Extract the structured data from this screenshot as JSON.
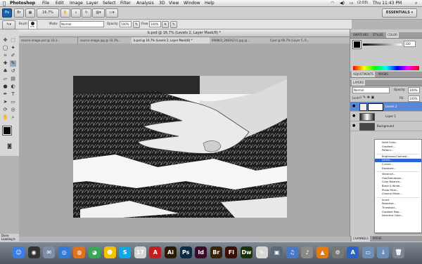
{
  "menubar": {
    "apple_label": "",
    "app_name": "Photoshop",
    "items": [
      "File",
      "Edit",
      "Image",
      "Layer",
      "Select",
      "Filter",
      "Analysis",
      "3D",
      "View",
      "Window",
      "Help"
    ],
    "battery": "(2:03)",
    "clock": "Thu 11:43 PM"
  },
  "appbar": {
    "ps_logo": "Ps",
    "zoom": "16.7%",
    "workspace": "ESSENTIALS ▾"
  },
  "options": {
    "brush_label": "Brush:",
    "brush_size": "175",
    "mode_label": "Mode:",
    "mode_value": "Normal",
    "opacity_label": "Opacity:",
    "opacity_value": "100%",
    "flow_label": "Flow:",
    "flow_value": "100%"
  },
  "document": {
    "title": "b.psd @ 16.7% (Levels 2, Layer Mask/8) *",
    "tabs": [
      "source-image.psd @ 33.3...",
      "source-image.jpg @ 33.3%...",
      "b.psd @ 16.7% (Levels 2, Layer Mask/8) *",
      "898803_26836231.jpg @...",
      "f.psd @ 66.7% (Layer 5, R..."
    ]
  },
  "status": {
    "left_text": "Done",
    "loading_text": "Loading b"
  },
  "panels": {
    "top_tabs": [
      "SWATCHES",
      "STYLES",
      "COLOR"
    ],
    "color_value": "100",
    "adjust_tabs": [
      "ADJUSTMENTS",
      "MASKS"
    ],
    "layers_tab": "LAYERS",
    "blend_mode": "Normal",
    "opacity_label": "Opacity:",
    "opacity_value": "100%",
    "lock_label": "Lock:",
    "fill_label": "Fill:",
    "fill_value": "100%",
    "layers": [
      {
        "name": "Levels 2"
      },
      {
        "name": "Layer 1"
      },
      {
        "name": "Background"
      }
    ],
    "bottom_tabs": [
      "CHANNELS",
      "PATHS"
    ]
  },
  "adjust_menu": [
    {
      "label": "Solid Color..."
    },
    {
      "label": "Gradient..."
    },
    {
      "label": "Pattern..."
    },
    {
      "sep": true
    },
    {
      "label": "Brightness/Contrast..."
    },
    {
      "label": "Levels...",
      "highlight": true
    },
    {
      "label": "Curves..."
    },
    {
      "label": "Exposure..."
    },
    {
      "sep": true
    },
    {
      "label": "Vibrance..."
    },
    {
      "label": "Hue/Saturation..."
    },
    {
      "label": "Color Balance..."
    },
    {
      "label": "Black & White..."
    },
    {
      "label": "Photo Filter..."
    },
    {
      "label": "Channel Mixer..."
    },
    {
      "sep": true
    },
    {
      "label": "Invert"
    },
    {
      "label": "Posterize..."
    },
    {
      "label": "Threshold..."
    },
    {
      "label": "Gradient Map..."
    },
    {
      "label": "Selective Color..."
    }
  ],
  "dock_icons": [
    {
      "name": "finder-icon",
      "glyph": "☺",
      "color": "#3c7de0"
    },
    {
      "name": "dashboard-icon",
      "glyph": "◉",
      "color": "#333333"
    },
    {
      "name": "mail-icon",
      "glyph": "✉",
      "color": "#7c8fa6"
    },
    {
      "name": "safari-icon",
      "glyph": "◎",
      "color": "#2f7bd6"
    },
    {
      "name": "firefox-icon",
      "glyph": "◍",
      "color": "#e2711d"
    },
    {
      "name": "chrome-icon",
      "glyph": "◕",
      "color": "#3aa757"
    },
    {
      "name": "messenger-icon",
      "glyph": "☻",
      "color": "#f2c200"
    },
    {
      "name": "skype-icon",
      "glyph": "S",
      "color": "#12a5e3"
    },
    {
      "name": "calendar-icon",
      "glyph": "17",
      "color": "#d5d5d5"
    },
    {
      "name": "acrobat-icon",
      "glyph": "A",
      "color": "#c41d1d"
    },
    {
      "name": "illustrator-icon",
      "glyph": "Ai",
      "color": "#2b1b05"
    },
    {
      "name": "photoshop-icon",
      "glyph": "Ps",
      "color": "#0b2a43"
    },
    {
      "name": "indesign-icon",
      "glyph": "Id",
      "color": "#3b0a2a"
    },
    {
      "name": "bridge-icon",
      "glyph": "Br",
      "color": "#3a2208"
    },
    {
      "name": "fireworks-icon",
      "glyph": "Fl",
      "color": "#3a0c02"
    },
    {
      "name": "dreamweaver-icon",
      "glyph": "Dw",
      "color": "#19310a"
    },
    {
      "name": "textedit-icon",
      "glyph": "✎",
      "color": "#d8d8d8"
    },
    {
      "name": "preview-icon",
      "glyph": "▣",
      "color": "#5a6a7a"
    },
    {
      "name": "itunes-icon",
      "glyph": "♫",
      "color": "#4a78c8"
    },
    {
      "name": "music-icon",
      "glyph": "♪",
      "color": "#8a8a8a"
    },
    {
      "name": "vlc-icon",
      "glyph": "▲",
      "color": "#e27b14"
    },
    {
      "name": "system-icon",
      "glyph": "⚙",
      "color": "#777777"
    },
    {
      "name": "apps-icon",
      "glyph": "A",
      "color": "#2a62c8"
    },
    {
      "name": "folder-icon",
      "glyph": "▭",
      "color": "#6c8fb8"
    },
    {
      "name": "downloads-icon",
      "glyph": "↓",
      "color": "#6c8fb8"
    },
    {
      "name": "trash-icon",
      "glyph": "🗑",
      "color": "#7d8792"
    }
  ]
}
